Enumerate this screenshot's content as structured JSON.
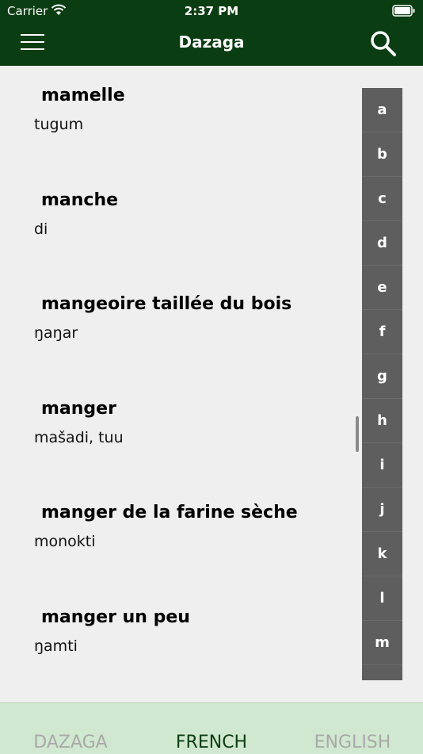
{
  "status_bar": {
    "carrier": "Carrier",
    "time": "2:37 PM"
  },
  "nav": {
    "title": "Dazaga",
    "menu_icon": "hamburger-icon",
    "search_icon": "search-icon"
  },
  "entries": [
    {
      "french": "mamelle",
      "dazaga": "tugum"
    },
    {
      "french": "manche",
      "dazaga": "di"
    },
    {
      "french": "mangeoire taillée du bois",
      "dazaga": "ŋaŋar"
    },
    {
      "french": "manger",
      "dazaga": "mašadi, tuu"
    },
    {
      "french": "manger de la farine sèche",
      "dazaga": "monokti"
    },
    {
      "french": "manger un peu",
      "dazaga": "ŋamti"
    }
  ],
  "index_letters": [
    "a",
    "b",
    "c",
    "d",
    "e",
    "f",
    "g",
    "h",
    "i",
    "j",
    "k",
    "l",
    "m"
  ],
  "tabs": [
    {
      "label": "DAZAGA",
      "selected": false
    },
    {
      "label": "FRENCH",
      "selected": true
    },
    {
      "label": "ENGLISH",
      "selected": false
    }
  ],
  "colors": {
    "header": "#0b3d12",
    "tab_bar": "#d0e8cf",
    "index_bg": "#5e5e5e",
    "selected_tab": "#0b3d12"
  }
}
